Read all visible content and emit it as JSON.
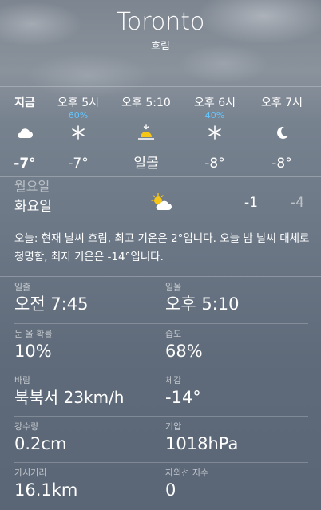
{
  "location": {
    "city": "Toronto",
    "condition": "흐림"
  },
  "hourly": [
    {
      "time": "지금",
      "precip": "",
      "icon": "cloud-icon",
      "temp": "-7°"
    },
    {
      "time": "오후 5시",
      "precip": "60%",
      "icon": "snowflake-icon",
      "temp": "-7°"
    },
    {
      "time": "오후 5:10",
      "precip": "",
      "icon": "sunset-icon",
      "temp": "일몰"
    },
    {
      "time": "오후 6시",
      "precip": "40%",
      "icon": "snowflake-icon",
      "temp": "-8°"
    },
    {
      "time": "오후 7시",
      "precip": "",
      "icon": "moon-icon",
      "temp": "-8°"
    }
  ],
  "daily": {
    "partial_label": "월요일",
    "day": "화요일",
    "icon": "sun-cloud-icon",
    "high": "-1",
    "low": "-4"
  },
  "summary": "오늘: 현재 날씨 흐림, 최고 기온은 2°입니다. 오늘 밤 날씨 대체로 청명함, 최저 기온은 -14°입니다.",
  "details": {
    "sunrise": {
      "label": "일출",
      "value": "오전 7:45"
    },
    "sunset": {
      "label": "일몰",
      "value": "오후 5:10"
    },
    "snow_chance": {
      "label": "눈 올 확률",
      "value": "10%"
    },
    "humidity": {
      "label": "습도",
      "value": "68%"
    },
    "wind": {
      "label": "바람",
      "value": "북북서 23km/h"
    },
    "feels_like": {
      "label": "체감",
      "value": "-14°"
    },
    "precipitation": {
      "label": "강수량",
      "value": "0.2cm"
    },
    "pressure": {
      "label": "기압",
      "value": "1018hPa"
    },
    "visibility": {
      "label": "가시거리",
      "value": "16.1km"
    },
    "uv_index": {
      "label": "자외선 지수",
      "value": "0"
    }
  },
  "colors": {
    "precip_blue": "#63c7ff",
    "sun_yellow": "#f5c518"
  }
}
